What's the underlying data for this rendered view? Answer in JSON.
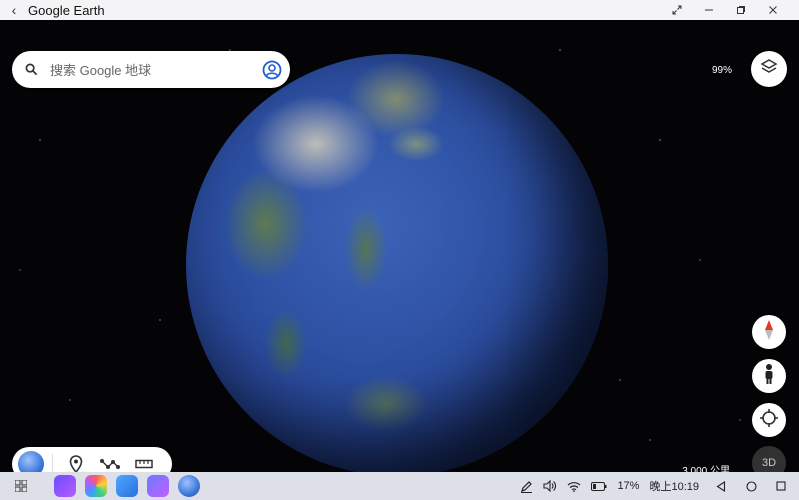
{
  "window": {
    "title": "Google Earth"
  },
  "search": {
    "placeholder": "搜索 Google 地球"
  },
  "map": {
    "zoom_percent": "99%",
    "scale_label": "3,000 公里",
    "view_mode_label": "3D"
  },
  "taskbar": {
    "battery": "17%",
    "time": "晚上10:19"
  },
  "colors": {
    "search_bar": "#ffffff",
    "taskbar": "#dde0e8",
    "space": "#040406",
    "ocean": "#2c4ea0"
  }
}
